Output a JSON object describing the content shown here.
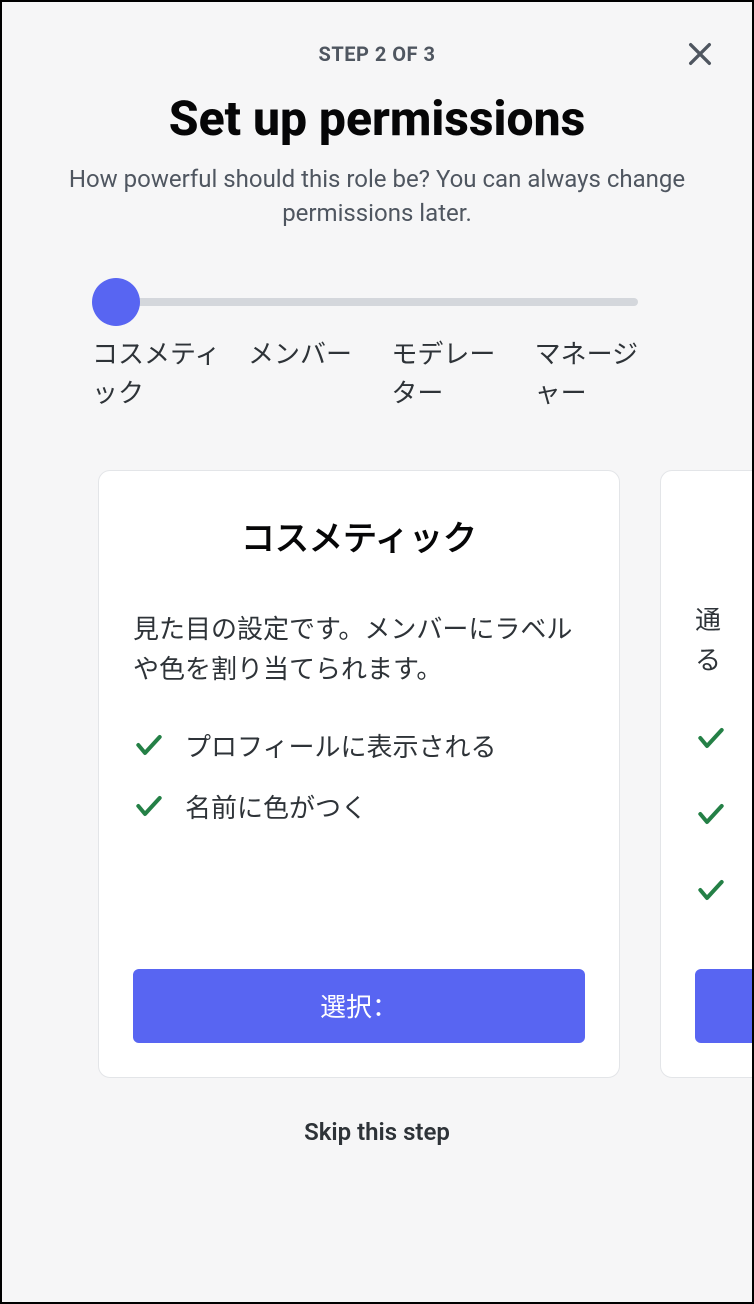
{
  "step_label": "STEP 2 OF 3",
  "title": "Set up permissions",
  "subtitle": "How powerful should this role be? You can always change permissions later.",
  "slider": {
    "labels": [
      "コスメティック",
      "メンバー",
      "モデレーター",
      "マネージャー"
    ]
  },
  "card": {
    "title": "コスメティック",
    "description": "見た目の設定です。メンバーにラベルや色を割り当てられます。",
    "features": [
      "プロフィールに表示される",
      "名前に色がつく"
    ],
    "button": "選択："
  },
  "peek": {
    "desc_line1": "通",
    "desc_line2": "る"
  },
  "skip": "Skip this step"
}
